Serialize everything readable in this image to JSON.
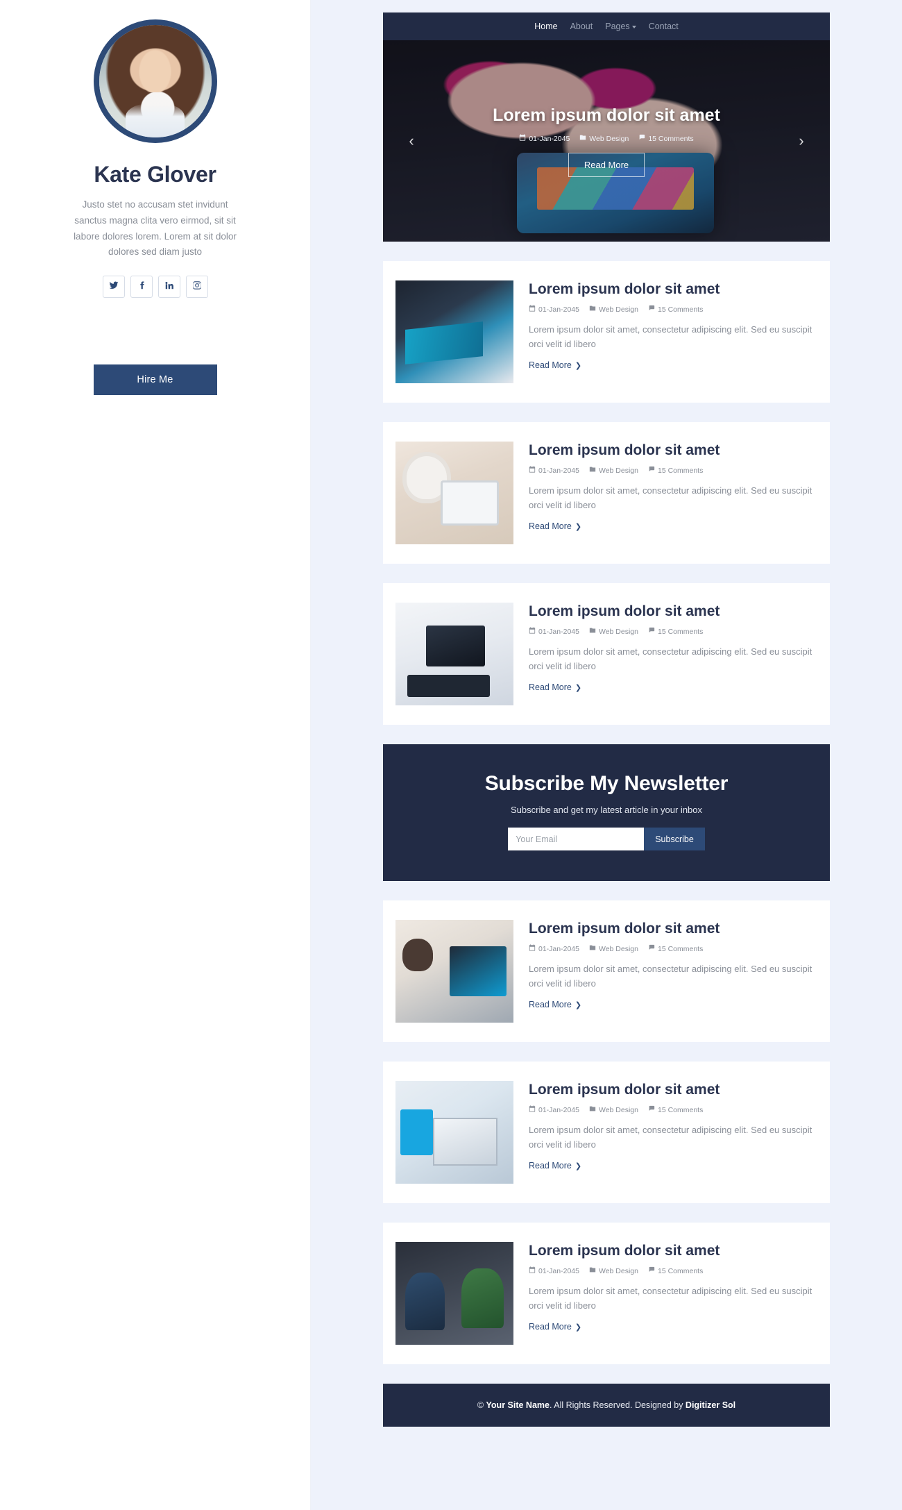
{
  "sidebar": {
    "avatar_alt": "avatar",
    "name": "Kate Glover",
    "bio": "Justo stet no accusam stet invidunt sanctus magna clita vero eirmod, sit sit labore dolores lorem. Lorem at sit dolor dolores sed diam justo",
    "social": [
      {
        "name": "twitter-icon",
        "label": "Twitter"
      },
      {
        "name": "facebook-icon",
        "label": "Facebook"
      },
      {
        "name": "linkedin-icon",
        "label": "LinkedIn"
      },
      {
        "name": "instagram-icon",
        "label": "Instagram"
      }
    ],
    "hire_button": "Hire Me"
  },
  "nav": {
    "items": [
      {
        "label": "Home",
        "active": true,
        "dropdown": false
      },
      {
        "label": "About",
        "active": false,
        "dropdown": false
      },
      {
        "label": "Pages",
        "active": false,
        "dropdown": true
      },
      {
        "label": "Contact",
        "active": false,
        "dropdown": false
      }
    ]
  },
  "hero": {
    "title": "Lorem ipsum dolor sit amet",
    "date": "01-Jan-2045",
    "category": "Web Design",
    "comments": "15 Comments",
    "read_more": "Read More",
    "prev_label": "‹",
    "next_label": "›"
  },
  "posts": [
    {
      "title": "Lorem ipsum dolor sit amet",
      "date": "01-Jan-2045",
      "category": "Web Design",
      "comments": "15 Comments",
      "excerpt": "Lorem ipsum dolor sit amet, consectetur adipiscing elit. Sed eu suscipit orci velit id libero",
      "read_more": "Read More",
      "thumb": "t1"
    },
    {
      "title": "Lorem ipsum dolor sit amet",
      "date": "01-Jan-2045",
      "category": "Web Design",
      "comments": "15 Comments",
      "excerpt": "Lorem ipsum dolor sit amet, consectetur adipiscing elit. Sed eu suscipit orci velit id libero",
      "read_more": "Read More",
      "thumb": "t2"
    },
    {
      "title": "Lorem ipsum dolor sit amet",
      "date": "01-Jan-2045",
      "category": "Web Design",
      "comments": "15 Comments",
      "excerpt": "Lorem ipsum dolor sit amet, consectetur adipiscing elit. Sed eu suscipit orci velit id libero",
      "read_more": "Read More",
      "thumb": "t3"
    }
  ],
  "newsletter": {
    "title": "Subscribe My Newsletter",
    "subtitle": "Subscribe and get my latest article in your inbox",
    "email_placeholder": "Your Email",
    "email_value": "",
    "button": "Subscribe"
  },
  "posts2": [
    {
      "title": "Lorem ipsum dolor sit amet",
      "date": "01-Jan-2045",
      "category": "Web Design",
      "comments": "15 Comments",
      "excerpt": "Lorem ipsum dolor sit amet, consectetur adipiscing elit. Sed eu suscipit orci velit id libero",
      "read_more": "Read More",
      "thumb": "t5"
    },
    {
      "title": "Lorem ipsum dolor sit amet",
      "date": "01-Jan-2045",
      "category": "Web Design",
      "comments": "15 Comments",
      "excerpt": "Lorem ipsum dolor sit amet, consectetur adipiscing elit. Sed eu suscipit orci velit id libero",
      "read_more": "Read More",
      "thumb": "t7"
    },
    {
      "title": "Lorem ipsum dolor sit amet",
      "date": "01-Jan-2045",
      "category": "Web Design",
      "comments": "15 Comments",
      "excerpt": "Lorem ipsum dolor sit amet, consectetur adipiscing elit. Sed eu suscipit orci velit id libero",
      "read_more": "Read More",
      "thumb": "t8"
    }
  ],
  "footer": {
    "copyright_symbol": "© ",
    "site_name": "Your Site Name",
    "rights": ". All Rights Reserved. Designed by ",
    "designer": "Digitizer Sol"
  },
  "colors": {
    "brand_dark": "#222b45",
    "brand_blue": "#2d4a77",
    "page_bg": "#eef2fb",
    "muted_text": "#8a8f98"
  }
}
